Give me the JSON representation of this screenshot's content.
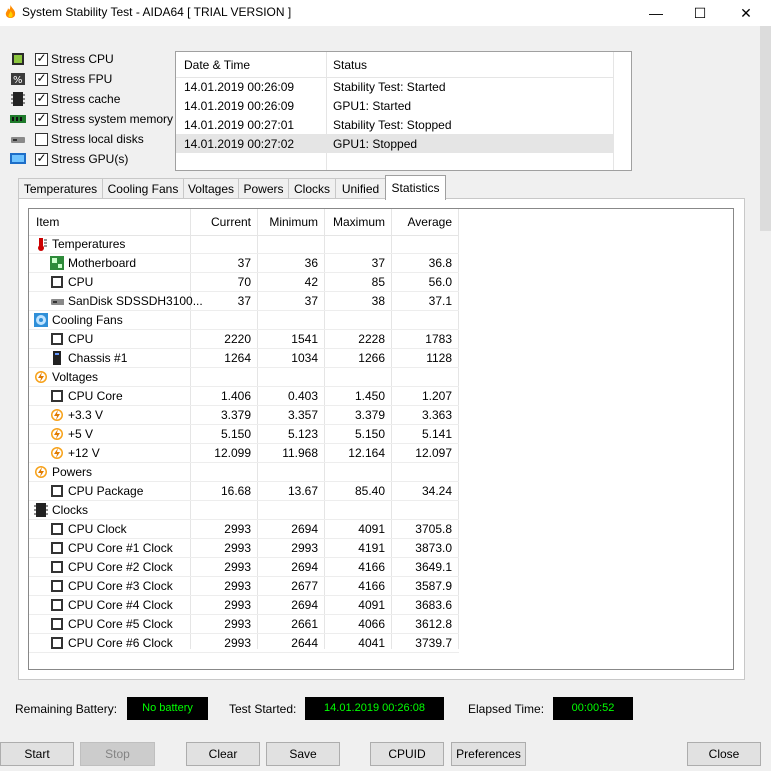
{
  "window": {
    "title": "System Stability Test - AIDA64  [ TRIAL VERSION ]",
    "controls": {
      "minimize": "—",
      "maximize": "☐",
      "close": "✕"
    }
  },
  "stress_options": [
    {
      "label": "Stress CPU",
      "checked": true,
      "icon": "cpu-icon"
    },
    {
      "label": "Stress FPU",
      "checked": true,
      "icon": "fpu-icon"
    },
    {
      "label": "Stress cache",
      "checked": true,
      "icon": "cache-icon"
    },
    {
      "label": "Stress system memory",
      "checked": true,
      "icon": "memory-icon"
    },
    {
      "label": "Stress local disks",
      "checked": false,
      "icon": "disk-icon"
    },
    {
      "label": "Stress GPU(s)",
      "checked": true,
      "icon": "gpu-icon"
    }
  ],
  "log": {
    "headers": {
      "datetime": "Date & Time",
      "status": "Status"
    },
    "rows": [
      {
        "datetime": "14.01.2019 00:26:09",
        "status": "Stability Test: Started"
      },
      {
        "datetime": "14.01.2019 00:26:09",
        "status": "GPU1: Started"
      },
      {
        "datetime": "14.01.2019 00:27:01",
        "status": "Stability Test: Stopped"
      },
      {
        "datetime": "14.01.2019 00:27:02",
        "status": "GPU1: Stopped"
      }
    ]
  },
  "tabs": [
    "Temperatures",
    "Cooling Fans",
    "Voltages",
    "Powers",
    "Clocks",
    "Unified",
    "Statistics"
  ],
  "active_tab": "Statistics",
  "stats": {
    "headers": {
      "item": "Item",
      "current": "Current",
      "minimum": "Minimum",
      "maximum": "Maximum",
      "average": "Average"
    },
    "rows": [
      {
        "type": "group",
        "item": "Temperatures",
        "icon": "thermometer-icon"
      },
      {
        "type": "item",
        "item": "Motherboard",
        "icon": "motherboard-icon",
        "current": "37",
        "minimum": "36",
        "maximum": "37",
        "average": "36.8"
      },
      {
        "type": "item",
        "item": "CPU",
        "icon": "chip-icon",
        "current": "70",
        "minimum": "42",
        "maximum": "85",
        "average": "56.0"
      },
      {
        "type": "item",
        "item": "SanDisk SDSSDH3100...",
        "icon": "disk-icon",
        "current": "37",
        "minimum": "37",
        "maximum": "38",
        "average": "37.1"
      },
      {
        "type": "group",
        "item": "Cooling Fans",
        "icon": "fan-icon"
      },
      {
        "type": "item",
        "item": "CPU",
        "icon": "chip-icon",
        "current": "2220",
        "minimum": "1541",
        "maximum": "2228",
        "average": "1783"
      },
      {
        "type": "item",
        "item": "Chassis #1",
        "icon": "chassis-icon",
        "current": "1264",
        "minimum": "1034",
        "maximum": "1266",
        "average": "1128"
      },
      {
        "type": "group",
        "item": "Voltages",
        "icon": "voltage-icon"
      },
      {
        "type": "item",
        "item": "CPU Core",
        "icon": "chip-icon",
        "current": "1.406",
        "minimum": "0.403",
        "maximum": "1.450",
        "average": "1.207"
      },
      {
        "type": "item",
        "item": "+3.3 V",
        "icon": "voltage-icon",
        "current": "3.379",
        "minimum": "3.357",
        "maximum": "3.379",
        "average": "3.363"
      },
      {
        "type": "item",
        "item": "+5 V",
        "icon": "voltage-icon",
        "current": "5.150",
        "minimum": "5.123",
        "maximum": "5.150",
        "average": "5.141"
      },
      {
        "type": "item",
        "item": "+12 V",
        "icon": "voltage-icon",
        "current": "12.099",
        "minimum": "11.968",
        "maximum": "12.164",
        "average": "12.097"
      },
      {
        "type": "group",
        "item": "Powers",
        "icon": "voltage-icon"
      },
      {
        "type": "item",
        "item": "CPU Package",
        "icon": "chip-icon",
        "current": "16.68",
        "minimum": "13.67",
        "maximum": "85.40",
        "average": "34.24"
      },
      {
        "type": "group",
        "item": "Clocks",
        "icon": "clock-chip-icon"
      },
      {
        "type": "item",
        "item": "CPU Clock",
        "icon": "chip-icon",
        "current": "2993",
        "minimum": "2694",
        "maximum": "4091",
        "average": "3705.8"
      },
      {
        "type": "item",
        "item": "CPU Core #1 Clock",
        "icon": "chip-icon",
        "current": "2993",
        "minimum": "2993",
        "maximum": "4191",
        "average": "3873.0"
      },
      {
        "type": "item",
        "item": "CPU Core #2 Clock",
        "icon": "chip-icon",
        "current": "2993",
        "minimum": "2694",
        "maximum": "4166",
        "average": "3649.1"
      },
      {
        "type": "item",
        "item": "CPU Core #3 Clock",
        "icon": "chip-icon",
        "current": "2993",
        "minimum": "2677",
        "maximum": "4166",
        "average": "3587.9"
      },
      {
        "type": "item",
        "item": "CPU Core #4 Clock",
        "icon": "chip-icon",
        "current": "2993",
        "minimum": "2694",
        "maximum": "4091",
        "average": "3683.6"
      },
      {
        "type": "item",
        "item": "CPU Core #5 Clock",
        "icon": "chip-icon",
        "current": "2993",
        "minimum": "2661",
        "maximum": "4066",
        "average": "3612.8"
      },
      {
        "type": "item",
        "item": "CPU Core #6 Clock",
        "icon": "chip-icon",
        "current": "2993",
        "minimum": "2644",
        "maximum": "4041",
        "average": "3739.7"
      }
    ]
  },
  "status": {
    "remaining_battery_label": "Remaining Battery:",
    "remaining_battery_value": "No battery",
    "test_started_label": "Test Started:",
    "test_started_value": "14.01.2019 00:26:08",
    "elapsed_label": "Elapsed Time:",
    "elapsed_value": "00:00:52"
  },
  "buttons": {
    "start": "Start",
    "stop": "Stop",
    "clear": "Clear",
    "save": "Save",
    "cpuid": "CPUID",
    "preferences": "Preferences",
    "close": "Close"
  },
  "colors": {
    "lcd_bg": "#000000",
    "lcd_text": "#00ff00",
    "selected_row": "#e5e5e5"
  }
}
